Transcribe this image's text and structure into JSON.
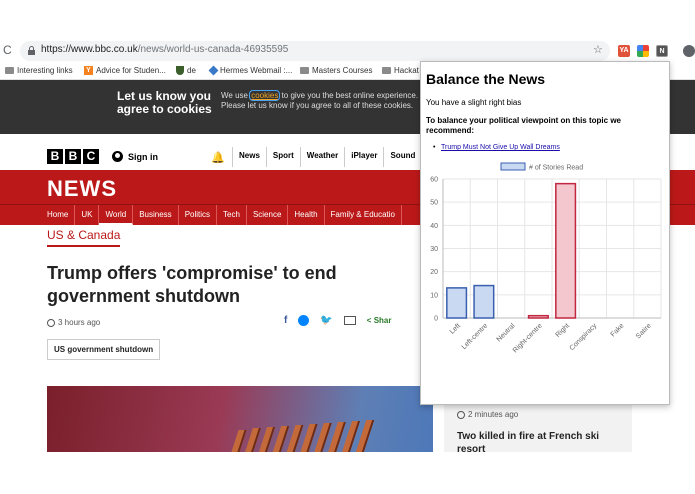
{
  "browser": {
    "url_host": "https://www.bbc.co.uk",
    "url_path": "/news/world-us-canada-46935595",
    "bookmarks": [
      "Interesting links",
      "Advice for Studen...",
      "de",
      "Hermes Webmail :...",
      "Masters Courses",
      "Hackat"
    ]
  },
  "cookie_banner": {
    "title": "Let us know you agree to cookies",
    "text_before": "We use ",
    "link": "cookies",
    "text_after": " to give you the best online experience. Please let us know if you agree to all of these cookies."
  },
  "bbc": {
    "logo": [
      "B",
      "B",
      "C"
    ],
    "sign_in": "Sign in",
    "top_nav": [
      "News",
      "Sport",
      "Weather",
      "iPlayer",
      "Sound"
    ],
    "news_logo": "NEWS",
    "sub_nav": [
      "Home",
      "UK",
      "World",
      "Business",
      "Politics",
      "Tech",
      "Science",
      "Health",
      "Family & Educatio"
    ],
    "section": "US & Canada",
    "headline": "Trump offers 'compromise' to end government shutdown",
    "time": "3 hours ago",
    "share_label": "Shar",
    "tag": "US government shutdown",
    "side_card": {
      "time": "2 minutes ago",
      "headline": "Two killed in fire at French ski resort"
    }
  },
  "popup": {
    "title": "Balance the News",
    "bias": "You have a slight right bias",
    "recommend": "To balance your political viewpoint on this topic we recommend:",
    "link": "Trump Must Not Give Up Wall Dreams"
  },
  "chart_data": {
    "type": "bar",
    "categories": [
      "Left",
      "Left-centre",
      "Neutral",
      "Right-centre",
      "Right",
      "Conspiracy",
      "Fake",
      "Satire"
    ],
    "series": [
      {
        "name": "# of Stories Read",
        "values": [
          13,
          14,
          0,
          1,
          58,
          0,
          0,
          0
        ]
      }
    ],
    "ylim": [
      0,
      60
    ],
    "yticks": [
      0,
      10,
      20,
      30,
      40,
      50,
      60
    ],
    "legend": "top",
    "grid": true,
    "colors": {
      "left_fill": "#c9d9f2",
      "left_stroke": "#3a5fb0",
      "right_fill": "#f4c7cf",
      "right_stroke": "#c0263f"
    }
  }
}
